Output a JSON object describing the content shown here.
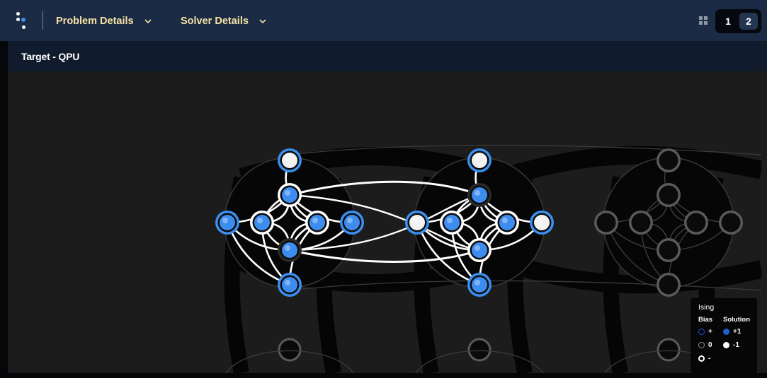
{
  "header": {
    "menus": [
      {
        "label": "Problem Details"
      },
      {
        "label": "Solver Details"
      }
    ],
    "pages": [
      {
        "label": "1",
        "active": false
      },
      {
        "label": "2",
        "active": true
      }
    ]
  },
  "panel": {
    "title": "Target - QPU"
  },
  "legend": {
    "title": "Ising",
    "bias_header": "Bias",
    "solution_header": "Solution",
    "bias_items": [
      "+",
      "0",
      "-"
    ],
    "solution_items": [
      "+1",
      "-1"
    ]
  },
  "colors": {
    "node_blue": "#3d8df0",
    "ring_blue": "#3b8fef",
    "ring_white": "#ffffff",
    "node_white": "#f2f2f2",
    "inactive": "#5a5a5a",
    "menu_text": "#f6e3a4",
    "accent": "#1f5fd1"
  },
  "graph": {
    "cells": [
      {
        "active": true,
        "nodes": [
          {
            "bias": "+",
            "solution": "-1"
          },
          {
            "bias": "-",
            "solution": "+1"
          },
          {
            "bias": "+",
            "solution": "+1"
          },
          {
            "bias": "-",
            "solution": "+1"
          },
          {
            "bias": "-",
            "solution": "+1"
          },
          {
            "bias": "+",
            "solution": "+1"
          },
          {
            "bias": "0",
            "solution": "+1"
          },
          {
            "bias": "+",
            "solution": "+1"
          }
        ]
      },
      {
        "active": true,
        "nodes": [
          {
            "bias": "+",
            "solution": "-1"
          },
          {
            "bias": "0",
            "solution": "+1"
          },
          {
            "bias": "+",
            "solution": "-1"
          },
          {
            "bias": "-",
            "solution": "+1"
          },
          {
            "bias": "-",
            "solution": "+1"
          },
          {
            "bias": "+",
            "solution": "-1"
          },
          {
            "bias": "-",
            "solution": "+1"
          },
          {
            "bias": "+",
            "solution": "+1"
          }
        ]
      },
      {
        "active": false,
        "nodes": [
          {
            "bias": "0",
            "solution": null
          },
          {
            "bias": "0",
            "solution": null
          },
          {
            "bias": "0",
            "solution": null
          },
          {
            "bias": "0",
            "solution": null
          },
          {
            "bias": "0",
            "solution": null
          },
          {
            "bias": "0",
            "solution": null
          },
          {
            "bias": "0",
            "solution": null
          },
          {
            "bias": "0",
            "solution": null
          }
        ]
      }
    ]
  }
}
